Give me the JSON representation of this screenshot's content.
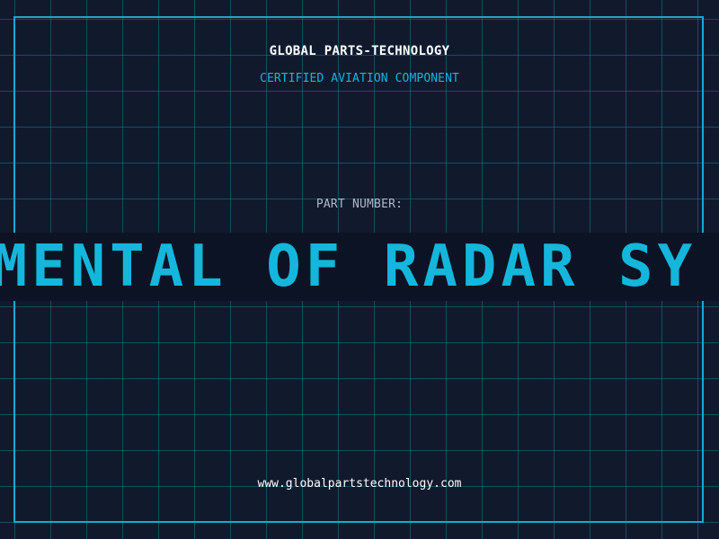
{
  "header": {
    "brand": "GLOBAL PARTS-TECHNOLOGY",
    "subtitle": "CERTIFIED AVIATION COMPONENT"
  },
  "part": {
    "label": "PART NUMBER:",
    "scrolling_value_visible": "AMENTAL OF RADAR SY"
  },
  "footer": {
    "website": "www.globalpartstechnology.com"
  },
  "colors": {
    "background": "#111a2d",
    "grid": "#268ba8",
    "frame": "#1aa9cf",
    "accent": "#14b6dc",
    "band": "#0c1324",
    "text_light": "#ffffff",
    "text_muted": "#aeb8c8"
  }
}
